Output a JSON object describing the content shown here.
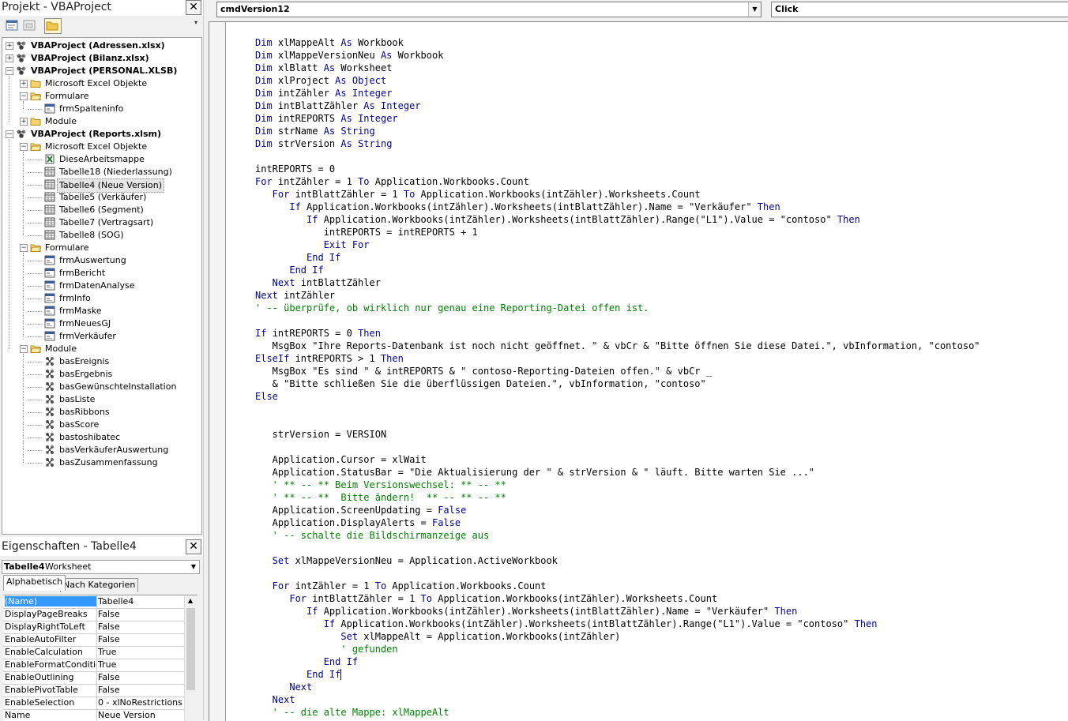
{
  "project_pane": {
    "title": "Projekt - VBAProject",
    "close": "✕",
    "tree": [
      {
        "label": "VBAProject (Adressen.xlsx)",
        "level": 0,
        "icon": "vbaproject-icon",
        "exp": "+",
        "bold": true
      },
      {
        "label": "VBAProject (Bilanz.xlsx)",
        "level": 0,
        "icon": "vbaproject-icon",
        "exp": "+",
        "bold": true
      },
      {
        "label": "VBAProject (PERSONAL.XLSB)",
        "level": 0,
        "icon": "vbaproject-icon",
        "exp": "−",
        "bold": true
      },
      {
        "label": "Microsoft Excel Objekte",
        "level": 1,
        "icon": "folder-icon",
        "exp": "+"
      },
      {
        "label": "Formulare",
        "level": 1,
        "icon": "folder-open-icon",
        "exp": "−"
      },
      {
        "label": "frmSpalteninfo",
        "level": 2,
        "icon": "form-icon"
      },
      {
        "label": "Module",
        "level": 1,
        "icon": "folder-icon",
        "exp": "+"
      },
      {
        "label": "VBAProject (Reports.xlsm)",
        "level": 0,
        "icon": "vbaproject-icon",
        "exp": "−",
        "bold": true
      },
      {
        "label": "Microsoft Excel Objekte",
        "level": 1,
        "icon": "folder-open-icon",
        "exp": "−"
      },
      {
        "label": "DieseArbeitsmappe",
        "level": 2,
        "icon": "workbook-icon"
      },
      {
        "label": "Tabelle18 (Niederlassung)",
        "level": 2,
        "icon": "sheet-icon"
      },
      {
        "label": "Tabelle4 (Neue Version)",
        "level": 2,
        "icon": "sheet-icon",
        "selected": true
      },
      {
        "label": "Tabelle5 (Verkäufer)",
        "level": 2,
        "icon": "sheet-icon"
      },
      {
        "label": "Tabelle6 (Segment)",
        "level": 2,
        "icon": "sheet-icon"
      },
      {
        "label": "Tabelle7 (Vertragsart)",
        "level": 2,
        "icon": "sheet-icon"
      },
      {
        "label": "Tabelle8 (SOG)",
        "level": 2,
        "icon": "sheet-icon"
      },
      {
        "label": "Formulare",
        "level": 1,
        "icon": "folder-open-icon",
        "exp": "−"
      },
      {
        "label": "frmAuswertung",
        "level": 2,
        "icon": "form-icon"
      },
      {
        "label": "frmBericht",
        "level": 2,
        "icon": "form-icon"
      },
      {
        "label": "frmDatenAnalyse",
        "level": 2,
        "icon": "form-icon"
      },
      {
        "label": "frmInfo",
        "level": 2,
        "icon": "form-icon"
      },
      {
        "label": "frmMaske",
        "level": 2,
        "icon": "form-icon"
      },
      {
        "label": "frmNeuesGJ",
        "level": 2,
        "icon": "form-icon"
      },
      {
        "label": "frmVerkäufer",
        "level": 2,
        "icon": "form-icon"
      },
      {
        "label": "Module",
        "level": 1,
        "icon": "folder-open-icon",
        "exp": "−"
      },
      {
        "label": "basEreignis",
        "level": 2,
        "icon": "module-icon"
      },
      {
        "label": "basErgebnis",
        "level": 2,
        "icon": "module-icon"
      },
      {
        "label": "basGewünschteInstallation",
        "level": 2,
        "icon": "module-icon"
      },
      {
        "label": "basListe",
        "level": 2,
        "icon": "module-icon"
      },
      {
        "label": "basRibbons",
        "level": 2,
        "icon": "module-icon"
      },
      {
        "label": "basScore",
        "level": 2,
        "icon": "module-icon"
      },
      {
        "label": "bastoshibatec",
        "level": 2,
        "icon": "module-icon"
      },
      {
        "label": "basVerkäuferAuswertung",
        "level": 2,
        "icon": "module-icon"
      },
      {
        "label": "basZusammenfassung",
        "level": 2,
        "icon": "module-icon"
      }
    ]
  },
  "properties_pane": {
    "title": "Eigenschaften - Tabelle4",
    "close": "✕",
    "object_name": "Tabelle4",
    "object_type": "Worksheet",
    "tabs": [
      "Alphabetisch",
      "Nach Kategorien"
    ],
    "rows": [
      {
        "name": "(Name)",
        "value": "Tabelle4",
        "selected": true
      },
      {
        "name": "DisplayPageBreaks",
        "value": "False"
      },
      {
        "name": "DisplayRightToLeft",
        "value": "False"
      },
      {
        "name": "EnableAutoFilter",
        "value": "False"
      },
      {
        "name": "EnableCalculation",
        "value": "True"
      },
      {
        "name": "EnableFormatConditions",
        "value": "True"
      },
      {
        "name": "EnableOutlining",
        "value": "False"
      },
      {
        "name": "EnablePivotTable",
        "value": "False"
      },
      {
        "name": "EnableSelection",
        "value": "0 - xlNoRestrictions"
      },
      {
        "name": "Name",
        "value": "Neue Version"
      }
    ]
  },
  "code_window": {
    "object_combo": "cmdVersion12",
    "procedure_combo": "Click",
    "lines": [
      [
        [
          "Dim ",
          "k"
        ],
        [
          "xlMappeAlt ",
          ""
        ],
        [
          "As ",
          "k"
        ],
        [
          "Workbook",
          ""
        ]
      ],
      [
        [
          "Dim ",
          "k"
        ],
        [
          "xlMappeVersionNeu ",
          ""
        ],
        [
          "As ",
          "k"
        ],
        [
          "Workbook",
          ""
        ]
      ],
      [
        [
          "Dim ",
          "k"
        ],
        [
          "xlBlatt ",
          ""
        ],
        [
          "As ",
          "k"
        ],
        [
          "Worksheet",
          ""
        ]
      ],
      [
        [
          "Dim ",
          "k"
        ],
        [
          "xlProject ",
          ""
        ],
        [
          "As ",
          "k"
        ],
        [
          "Object",
          "k"
        ]
      ],
      [
        [
          "Dim ",
          "k"
        ],
        [
          "intZähler ",
          ""
        ],
        [
          "As ",
          "k"
        ],
        [
          "Integer",
          "k"
        ]
      ],
      [
        [
          "Dim ",
          "k"
        ],
        [
          "intBlattZähler ",
          ""
        ],
        [
          "As ",
          "k"
        ],
        [
          "Integer",
          "k"
        ]
      ],
      [
        [
          "Dim ",
          "k"
        ],
        [
          "intREPORTS ",
          ""
        ],
        [
          "As ",
          "k"
        ],
        [
          "Integer",
          "k"
        ]
      ],
      [
        [
          "Dim ",
          "k"
        ],
        [
          "strName ",
          ""
        ],
        [
          "As ",
          "k"
        ],
        [
          "String",
          "k"
        ]
      ],
      [
        [
          "Dim ",
          "k"
        ],
        [
          "strVersion ",
          ""
        ],
        [
          "As ",
          "k"
        ],
        [
          "String",
          "k"
        ]
      ],
      [],
      [
        [
          "intREPORTS = 0",
          ""
        ]
      ],
      [
        [
          "For ",
          "k"
        ],
        [
          "intZähler = 1 ",
          ""
        ],
        [
          "To ",
          "k"
        ],
        [
          "Application.Workbooks.Count",
          ""
        ]
      ],
      [
        [
          "   For ",
          "k"
        ],
        [
          "intBlattZähler = 1 ",
          ""
        ],
        [
          "To ",
          "k"
        ],
        [
          "Application.Workbooks(intZähler).Worksheets.Count",
          ""
        ]
      ],
      [
        [
          "      If ",
          "k"
        ],
        [
          "Application.Workbooks(intZähler).Worksheets(intBlattZähler).Name = \"Verkäufer\" ",
          ""
        ],
        [
          "Then",
          "k"
        ]
      ],
      [
        [
          "         If ",
          "k"
        ],
        [
          "Application.Workbooks(intZähler).Worksheets(intBlattZähler).Range(\"L1\").Value = \"contoso\" ",
          ""
        ],
        [
          "Then",
          "k"
        ]
      ],
      [
        [
          "            intREPORTS = intREPORTS + 1",
          ""
        ]
      ],
      [
        [
          "            Exit For",
          "k"
        ]
      ],
      [
        [
          "         End If",
          "k"
        ]
      ],
      [
        [
          "      End If",
          "k"
        ]
      ],
      [
        [
          "   Next ",
          "k"
        ],
        [
          "intBlattZähler",
          ""
        ]
      ],
      [
        [
          "Next ",
          "k"
        ],
        [
          "intZähler",
          ""
        ]
      ],
      [
        [
          "' -- überprüfe, ob wirklich nur genau eine Reporting-Datei offen ist.",
          "c"
        ]
      ],
      [],
      [
        [
          "If ",
          "k"
        ],
        [
          "intREPORTS = 0 ",
          ""
        ],
        [
          "Then",
          "k"
        ]
      ],
      [
        [
          "   MsgBox \"Ihre Reports-Datenbank ist noch nicht geöffnet. \" & vbCr & \"Bitte öffnen Sie diese Datei.\", vbInformation, \"contoso\"",
          ""
        ]
      ],
      [
        [
          "ElseIf ",
          "k"
        ],
        [
          "intREPORTS > 1 ",
          ""
        ],
        [
          "Then",
          "k"
        ]
      ],
      [
        [
          "   MsgBox \"Es sind \" & intREPORTS & \" contoso-Reporting-Dateien offen.\" & vbCr _",
          ""
        ]
      ],
      [
        [
          "   & \"Bitte schließen Sie die überflüssigen Dateien.\", vbInformation, \"contoso\"",
          ""
        ]
      ],
      [
        [
          "Else",
          "k"
        ]
      ],
      [],
      [],
      [
        [
          "   strVersion = VERSION",
          ""
        ]
      ],
      [],
      [
        [
          "   Application.Cursor = xlWait",
          ""
        ]
      ],
      [
        [
          "   Application.StatusBar = \"Die Aktualisierung der \" & strVersion & \" läuft. Bitte warten Sie ...\"",
          ""
        ]
      ],
      [
        [
          "   ' ** -- ** Beim Versionswechsel: ** -- **",
          "c"
        ]
      ],
      [
        [
          "   ' ** -- **  Bitte ändern!  ** -- ** -- **",
          "c"
        ]
      ],
      [
        [
          "   Application.ScreenUpdating = ",
          ""
        ],
        [
          "False",
          "k"
        ]
      ],
      [
        [
          "   Application.DisplayAlerts = ",
          ""
        ],
        [
          "False",
          "k"
        ]
      ],
      [
        [
          "   ' -- schalte die Bildschirmanzeige aus",
          "c"
        ]
      ],
      [],
      [
        [
          "   Set ",
          "k"
        ],
        [
          "xlMappeVersionNeu = Application.ActiveWorkbook",
          ""
        ]
      ],
      [],
      [
        [
          "   For ",
          "k"
        ],
        [
          "intZähler = 1 ",
          ""
        ],
        [
          "To ",
          "k"
        ],
        [
          "Application.Workbooks.Count",
          ""
        ]
      ],
      [
        [
          "      For ",
          "k"
        ],
        [
          "intBlattZähler = 1 ",
          ""
        ],
        [
          "To ",
          "k"
        ],
        [
          "Application.Workbooks(intZähler).Worksheets.Count",
          ""
        ]
      ],
      [
        [
          "         If ",
          "k"
        ],
        [
          "Application.Workbooks(intZähler).Worksheets(intBlattZähler).Name = \"Verkäufer\" ",
          ""
        ],
        [
          "Then",
          "k"
        ]
      ],
      [
        [
          "            If ",
          "k"
        ],
        [
          "Application.Workbooks(intZähler).Worksheets(intBlattZähler).Range(\"L1\").Value = \"contoso\" ",
          ""
        ],
        [
          "Then",
          "k"
        ]
      ],
      [
        [
          "               Set ",
          "k"
        ],
        [
          "xlMappeAlt = Application.Workbooks(intZähler)",
          ""
        ]
      ],
      [
        [
          "               ' gefunden",
          "c"
        ]
      ],
      [
        [
          "            End If",
          "k"
        ]
      ],
      [
        [
          "         End If",
          "k"
        ],
        [
          "",
          "caret"
        ]
      ],
      [
        [
          "      Next",
          "k"
        ]
      ],
      [
        [
          "   Next",
          "k"
        ]
      ],
      [
        [
          "   ' -- die alte Mappe: xlMappeAlt",
          "c"
        ]
      ]
    ]
  }
}
